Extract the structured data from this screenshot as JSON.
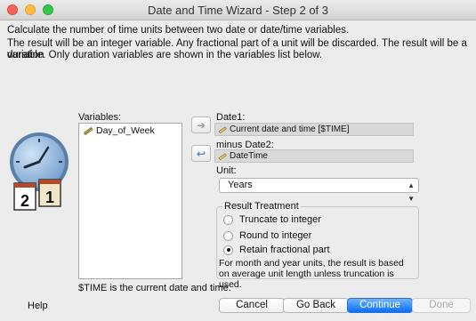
{
  "window": {
    "title": "Date and Time Wizard - Step 2 of 3"
  },
  "instructions": {
    "line1": "Calculate the number of time units between two date or date/time variables.",
    "line2": "The result will be an integer variable. Any fractional part of a unit will be discarded. The result will be a duration",
    "line3": "variable. Only duration variables are shown in the variables list below."
  },
  "variables": {
    "label": "Variables:",
    "items": [
      "Day_of_Week"
    ]
  },
  "date1": {
    "label": "Date1:",
    "value": "Current date and time [$TIME]"
  },
  "date2": {
    "label": "minus Date2:",
    "value": "DateTime"
  },
  "unit": {
    "label": "Unit:",
    "selected": "Years"
  },
  "result_treatment": {
    "title": "Result Treatment",
    "options": [
      {
        "label": "Truncate to integer",
        "selected": false
      },
      {
        "label": "Round to integer",
        "selected": false
      },
      {
        "label": "Retain fractional part",
        "selected": true
      }
    ],
    "note": "For month and year units, the result is based on average unit length unless truncation is used."
  },
  "footer_note": "$TIME is the current date and time.",
  "buttons": {
    "help": "Help",
    "cancel": "Cancel",
    "go_back": "Go Back",
    "continue": "Continue",
    "done": "Done"
  },
  "illustration": {
    "calendar_digits": [
      "2",
      "1"
    ]
  },
  "icons": {
    "move_to_date1": "arrow-right-icon",
    "move_to_date2": "arrow-left-icon",
    "variable": "ruler-pencil-icon",
    "unit_dropdown": "chevron-up-down-icon"
  },
  "colors": {
    "accent": "#0a6ffb",
    "window_bg": "#ececec"
  }
}
